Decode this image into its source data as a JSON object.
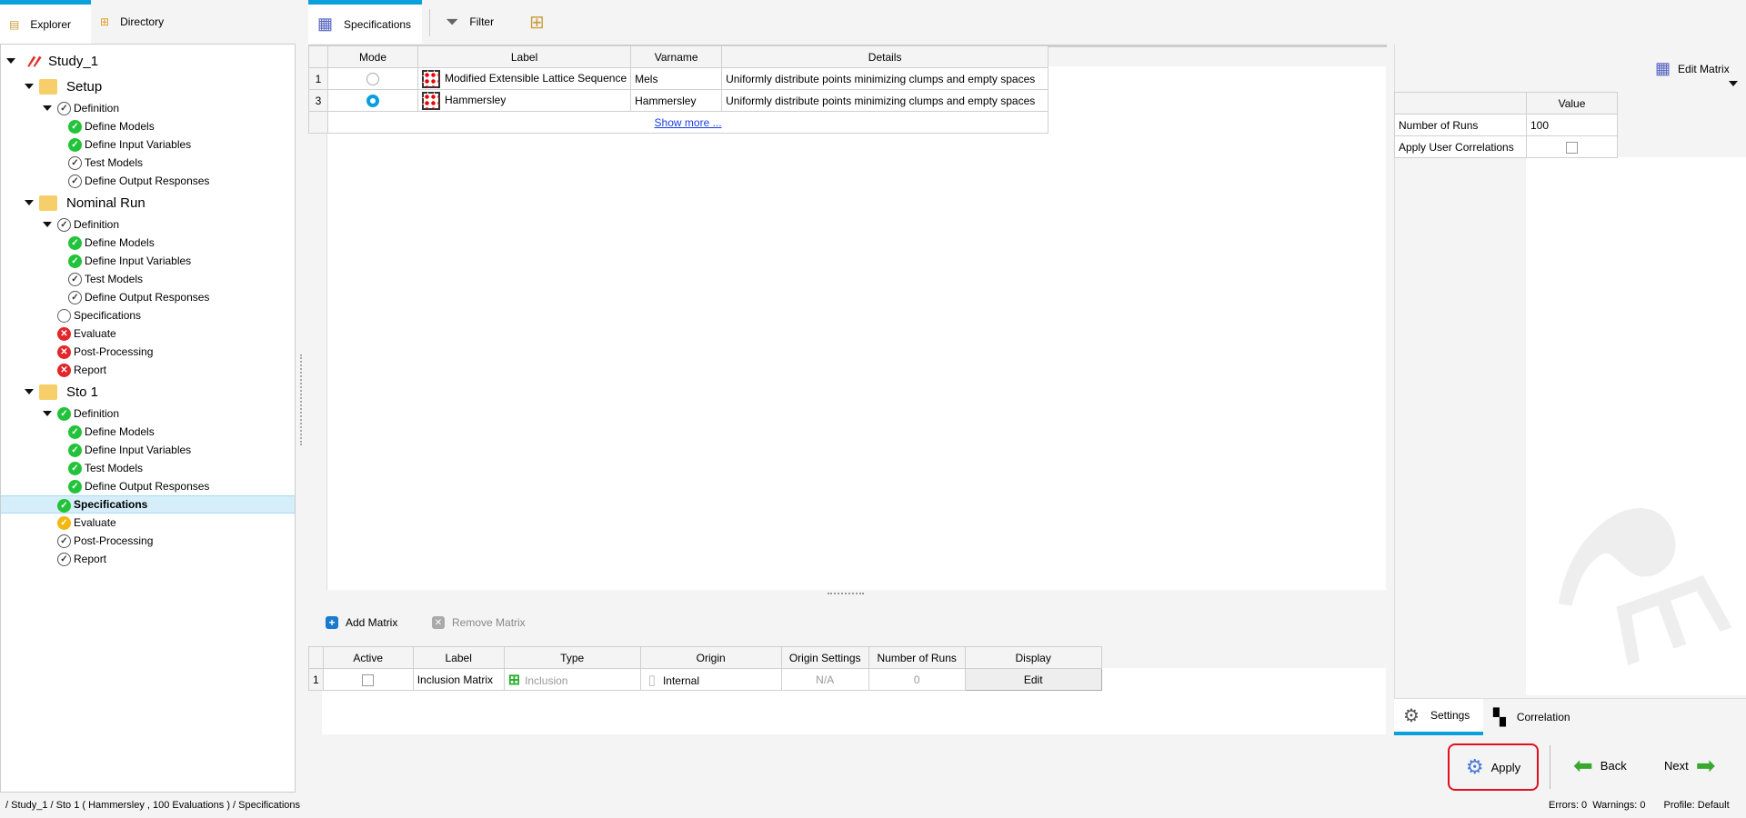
{
  "left_tabs": [
    "Explorer",
    "Directory"
  ],
  "main_tabs": {
    "specifications": "Specifications",
    "filter": "Filter"
  },
  "tree": [
    {
      "label": "Study_1",
      "level": 0,
      "status": "study",
      "large": true,
      "caret": true
    },
    {
      "label": "Setup",
      "level": 1,
      "status": "folder",
      "large": true,
      "caret": true
    },
    {
      "label": "Definition",
      "level": 2,
      "status": "done",
      "caret": true
    },
    {
      "label": "Define Models",
      "level": 3,
      "status": "ok"
    },
    {
      "label": "Define Input Variables",
      "level": 3,
      "status": "ok"
    },
    {
      "label": "Test Models",
      "level": 3,
      "status": "done"
    },
    {
      "label": "Define Output Responses",
      "level": 3,
      "status": "done"
    },
    {
      "label": "Nominal Run",
      "level": 1,
      "status": "folder",
      "large": true,
      "caret": true
    },
    {
      "label": "Definition",
      "level": 2,
      "status": "done",
      "caret": true
    },
    {
      "label": "Define Models",
      "level": 3,
      "status": "ok"
    },
    {
      "label": "Define Input Variables",
      "level": 3,
      "status": "ok"
    },
    {
      "label": "Test Models",
      "level": 3,
      "status": "done"
    },
    {
      "label": "Define Output Responses",
      "level": 3,
      "status": "done"
    },
    {
      "label": "Specifications",
      "level": 2,
      "status": "none"
    },
    {
      "label": "Evaluate",
      "level": 2,
      "status": "err"
    },
    {
      "label": "Post-Processing",
      "level": 2,
      "status": "err"
    },
    {
      "label": "Report",
      "level": 2,
      "status": "err"
    },
    {
      "label": "Sto 1",
      "level": 1,
      "status": "folder",
      "large": true,
      "caret": true
    },
    {
      "label": "Definition",
      "level": 2,
      "status": "ok",
      "caret": true
    },
    {
      "label": "Define Models",
      "level": 3,
      "status": "ok"
    },
    {
      "label": "Define Input Variables",
      "level": 3,
      "status": "ok"
    },
    {
      "label": "Test Models",
      "level": 3,
      "status": "ok"
    },
    {
      "label": "Define Output Responses",
      "level": 3,
      "status": "ok"
    },
    {
      "label": "Specifications",
      "level": 2,
      "status": "ok",
      "selected": true
    },
    {
      "label": "Evaluate",
      "level": 2,
      "status": "warn"
    },
    {
      "label": "Post-Processing",
      "level": 2,
      "status": "done"
    },
    {
      "label": "Report",
      "level": 2,
      "status": "done"
    }
  ],
  "methods": {
    "headers": [
      "Mode",
      "Label",
      "Varname",
      "Details"
    ],
    "rows": [
      {
        "num": "1",
        "selected": false,
        "label": "Modified Extensible Lattice Sequence",
        "varname": "Mels",
        "details": "Uniformly distribute points minimizing clumps and empty spaces"
      },
      {
        "num": "3",
        "selected": true,
        "label": "Hammersley",
        "varname": "Hammersley",
        "details": "Uniformly distribute points minimizing clumps and empty spaces"
      }
    ],
    "show_more": "Show more ..."
  },
  "matrix_toolbar": {
    "add": "Add Matrix",
    "remove": "Remove Matrix"
  },
  "matrices": {
    "headers": [
      "Active",
      "Label",
      "Type",
      "Origin",
      "Origin Settings",
      "Number of Runs",
      "Display"
    ],
    "rows": [
      {
        "num": "1",
        "active": false,
        "label": "Inclusion Matrix",
        "type": "Inclusion",
        "origin": "Internal",
        "origin_settings": "N/A",
        "runs": "0",
        "display": "Edit"
      }
    ]
  },
  "settings": {
    "edit_matrix": "Edit Matrix",
    "value_header": "Value",
    "rows": [
      {
        "name": "Number of Runs",
        "value": "100"
      },
      {
        "name": "Apply User Correlations",
        "checked": false
      }
    ],
    "tabs": [
      "Settings",
      "Correlation"
    ]
  },
  "actions": {
    "apply": "Apply",
    "back": "Back",
    "next": "Next"
  },
  "status": {
    "path": "/ Study_1 / Sto 1 ( Hammersley , 100 Evaluations ) / Specifications",
    "errors": "Errors: 0",
    "warnings": "Warnings: 0",
    "profile": "Profile: Default"
  },
  "colors": {
    "accent": "#0aa0dc",
    "selection": "#d5eef9",
    "apply_border": "#e0101e"
  }
}
